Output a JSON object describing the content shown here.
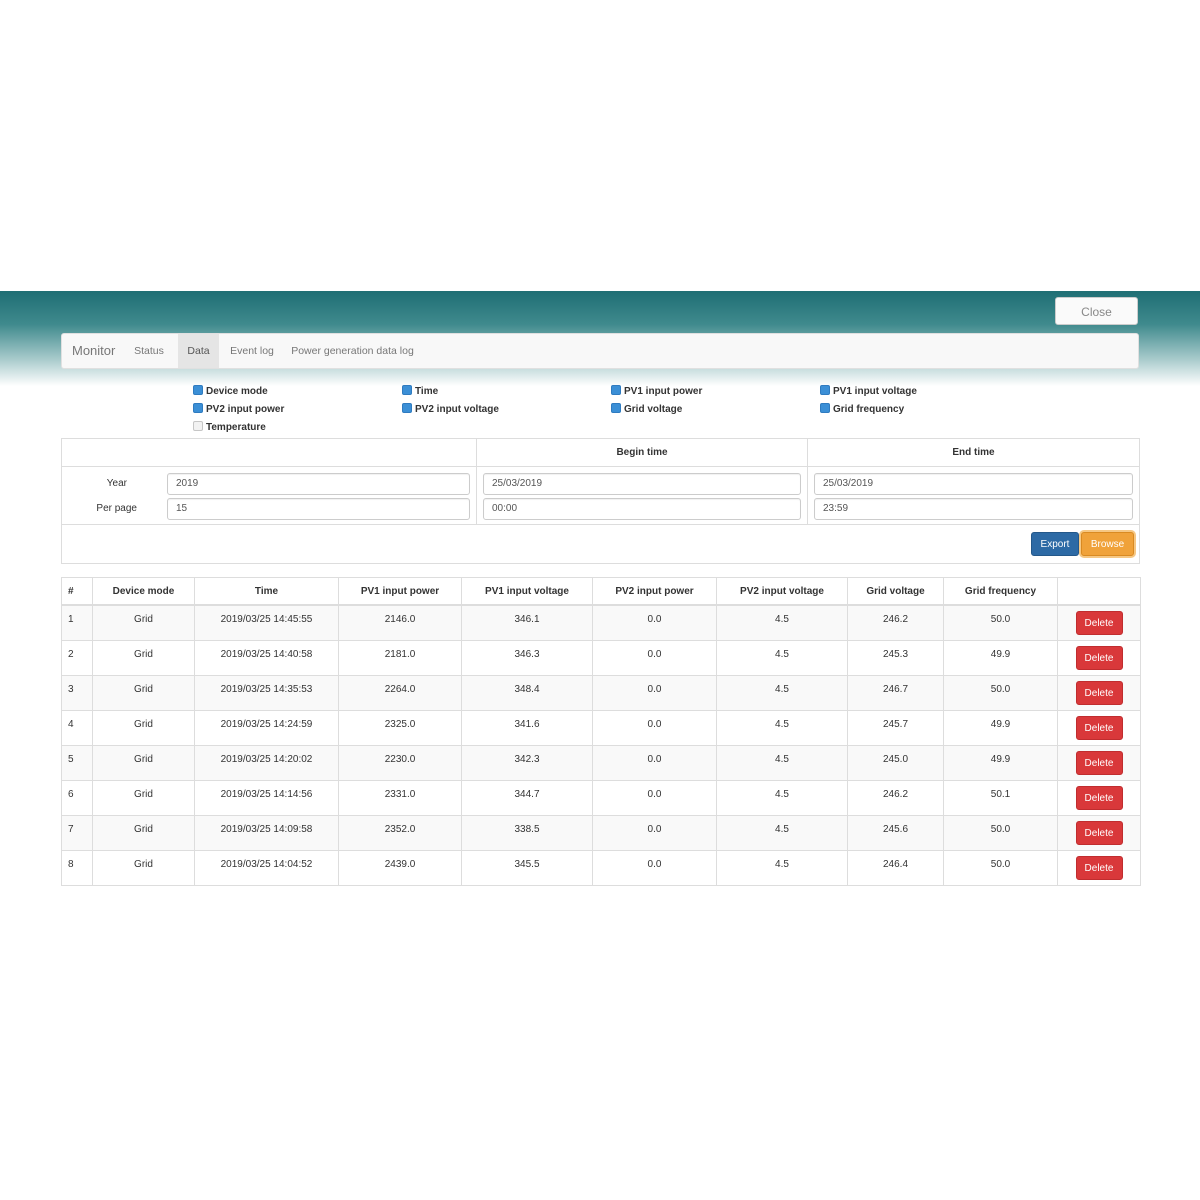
{
  "window": {
    "close_label": "Close"
  },
  "nav": {
    "brand": "Monitor",
    "tabs": [
      {
        "label": "Status"
      },
      {
        "label": "Data"
      },
      {
        "label": "Event log"
      },
      {
        "label": "Power generation data log"
      }
    ],
    "active_tab": "Data"
  },
  "columns_filter": [
    {
      "label": "Device mode",
      "checked": true
    },
    {
      "label": "Time",
      "checked": true
    },
    {
      "label": "PV1 input power",
      "checked": true
    },
    {
      "label": "PV1 input voltage",
      "checked": true
    },
    {
      "label": "PV2 input power",
      "checked": true
    },
    {
      "label": "PV2 input voltage",
      "checked": true
    },
    {
      "label": "Grid voltage",
      "checked": true
    },
    {
      "label": "Grid frequency",
      "checked": true
    },
    {
      "label": "Temperature",
      "checked": false
    }
  ],
  "query": {
    "begin_time_header": "Begin time",
    "end_time_header": "End time",
    "year_label": "Year",
    "year_value": "2019",
    "per_page_label": "Per page",
    "per_page_value": "15",
    "begin_date": "25/03/2019",
    "begin_time": "00:00",
    "end_date": "25/03/2019",
    "end_time": "23:59",
    "export_label": "Export",
    "browse_label": "Browse"
  },
  "table": {
    "headers": [
      "#",
      "Device mode",
      "Time",
      "PV1 input power",
      "PV1 input voltage",
      "PV2 input power",
      "PV2 input voltage",
      "Grid voltage",
      "Grid frequency",
      ""
    ],
    "delete_label": "Delete",
    "rows": [
      [
        "1",
        "Grid",
        "2019/03/25 14:45:55",
        "2146.0",
        "346.1",
        "0.0",
        "4.5",
        "246.2",
        "50.0"
      ],
      [
        "2",
        "Grid",
        "2019/03/25 14:40:58",
        "2181.0",
        "346.3",
        "0.0",
        "4.5",
        "245.3",
        "49.9"
      ],
      [
        "3",
        "Grid",
        "2019/03/25 14:35:53",
        "2264.0",
        "348.4",
        "0.0",
        "4.5",
        "246.7",
        "50.0"
      ],
      [
        "4",
        "Grid",
        "2019/03/25 14:24:59",
        "2325.0",
        "341.6",
        "0.0",
        "4.5",
        "245.7",
        "49.9"
      ],
      [
        "5",
        "Grid",
        "2019/03/25 14:20:02",
        "2230.0",
        "342.3",
        "0.0",
        "4.5",
        "245.0",
        "49.9"
      ],
      [
        "6",
        "Grid",
        "2019/03/25 14:14:56",
        "2331.0",
        "344.7",
        "0.0",
        "4.5",
        "246.2",
        "50.1"
      ],
      [
        "7",
        "Grid",
        "2019/03/25 14:09:58",
        "2352.0",
        "338.5",
        "0.0",
        "4.5",
        "245.6",
        "50.0"
      ],
      [
        "8",
        "Grid",
        "2019/03/25 14:04:52",
        "2439.0",
        "345.5",
        "0.0",
        "4.5",
        "246.4",
        "50.0"
      ]
    ]
  }
}
